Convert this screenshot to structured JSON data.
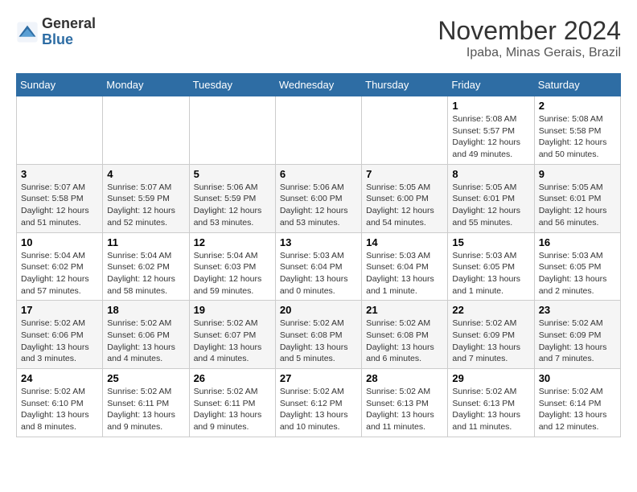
{
  "header": {
    "logo_general": "General",
    "logo_blue": "Blue",
    "month_title": "November 2024",
    "subtitle": "Ipaba, Minas Gerais, Brazil"
  },
  "days_of_week": [
    "Sunday",
    "Monday",
    "Tuesday",
    "Wednesday",
    "Thursday",
    "Friday",
    "Saturday"
  ],
  "weeks": [
    [
      {
        "day": "",
        "info": ""
      },
      {
        "day": "",
        "info": ""
      },
      {
        "day": "",
        "info": ""
      },
      {
        "day": "",
        "info": ""
      },
      {
        "day": "",
        "info": ""
      },
      {
        "day": "1",
        "info": "Sunrise: 5:08 AM\nSunset: 5:57 PM\nDaylight: 12 hours\nand 49 minutes."
      },
      {
        "day": "2",
        "info": "Sunrise: 5:08 AM\nSunset: 5:58 PM\nDaylight: 12 hours\nand 50 minutes."
      }
    ],
    [
      {
        "day": "3",
        "info": "Sunrise: 5:07 AM\nSunset: 5:58 PM\nDaylight: 12 hours\nand 51 minutes."
      },
      {
        "day": "4",
        "info": "Sunrise: 5:07 AM\nSunset: 5:59 PM\nDaylight: 12 hours\nand 52 minutes."
      },
      {
        "day": "5",
        "info": "Sunrise: 5:06 AM\nSunset: 5:59 PM\nDaylight: 12 hours\nand 53 minutes."
      },
      {
        "day": "6",
        "info": "Sunrise: 5:06 AM\nSunset: 6:00 PM\nDaylight: 12 hours\nand 53 minutes."
      },
      {
        "day": "7",
        "info": "Sunrise: 5:05 AM\nSunset: 6:00 PM\nDaylight: 12 hours\nand 54 minutes."
      },
      {
        "day": "8",
        "info": "Sunrise: 5:05 AM\nSunset: 6:01 PM\nDaylight: 12 hours\nand 55 minutes."
      },
      {
        "day": "9",
        "info": "Sunrise: 5:05 AM\nSunset: 6:01 PM\nDaylight: 12 hours\nand 56 minutes."
      }
    ],
    [
      {
        "day": "10",
        "info": "Sunrise: 5:04 AM\nSunset: 6:02 PM\nDaylight: 12 hours\nand 57 minutes."
      },
      {
        "day": "11",
        "info": "Sunrise: 5:04 AM\nSunset: 6:02 PM\nDaylight: 12 hours\nand 58 minutes."
      },
      {
        "day": "12",
        "info": "Sunrise: 5:04 AM\nSunset: 6:03 PM\nDaylight: 12 hours\nand 59 minutes."
      },
      {
        "day": "13",
        "info": "Sunrise: 5:03 AM\nSunset: 6:04 PM\nDaylight: 13 hours\nand 0 minutes."
      },
      {
        "day": "14",
        "info": "Sunrise: 5:03 AM\nSunset: 6:04 PM\nDaylight: 13 hours\nand 1 minute."
      },
      {
        "day": "15",
        "info": "Sunrise: 5:03 AM\nSunset: 6:05 PM\nDaylight: 13 hours\nand 1 minute."
      },
      {
        "day": "16",
        "info": "Sunrise: 5:03 AM\nSunset: 6:05 PM\nDaylight: 13 hours\nand 2 minutes."
      }
    ],
    [
      {
        "day": "17",
        "info": "Sunrise: 5:02 AM\nSunset: 6:06 PM\nDaylight: 13 hours\nand 3 minutes."
      },
      {
        "day": "18",
        "info": "Sunrise: 5:02 AM\nSunset: 6:06 PM\nDaylight: 13 hours\nand 4 minutes."
      },
      {
        "day": "19",
        "info": "Sunrise: 5:02 AM\nSunset: 6:07 PM\nDaylight: 13 hours\nand 4 minutes."
      },
      {
        "day": "20",
        "info": "Sunrise: 5:02 AM\nSunset: 6:08 PM\nDaylight: 13 hours\nand 5 minutes."
      },
      {
        "day": "21",
        "info": "Sunrise: 5:02 AM\nSunset: 6:08 PM\nDaylight: 13 hours\nand 6 minutes."
      },
      {
        "day": "22",
        "info": "Sunrise: 5:02 AM\nSunset: 6:09 PM\nDaylight: 13 hours\nand 7 minutes."
      },
      {
        "day": "23",
        "info": "Sunrise: 5:02 AM\nSunset: 6:09 PM\nDaylight: 13 hours\nand 7 minutes."
      }
    ],
    [
      {
        "day": "24",
        "info": "Sunrise: 5:02 AM\nSunset: 6:10 PM\nDaylight: 13 hours\nand 8 minutes."
      },
      {
        "day": "25",
        "info": "Sunrise: 5:02 AM\nSunset: 6:11 PM\nDaylight: 13 hours\nand 9 minutes."
      },
      {
        "day": "26",
        "info": "Sunrise: 5:02 AM\nSunset: 6:11 PM\nDaylight: 13 hours\nand 9 minutes."
      },
      {
        "day": "27",
        "info": "Sunrise: 5:02 AM\nSunset: 6:12 PM\nDaylight: 13 hours\nand 10 minutes."
      },
      {
        "day": "28",
        "info": "Sunrise: 5:02 AM\nSunset: 6:13 PM\nDaylight: 13 hours\nand 11 minutes."
      },
      {
        "day": "29",
        "info": "Sunrise: 5:02 AM\nSunset: 6:13 PM\nDaylight: 13 hours\nand 11 minutes."
      },
      {
        "day": "30",
        "info": "Sunrise: 5:02 AM\nSunset: 6:14 PM\nDaylight: 13 hours\nand 12 minutes."
      }
    ]
  ]
}
